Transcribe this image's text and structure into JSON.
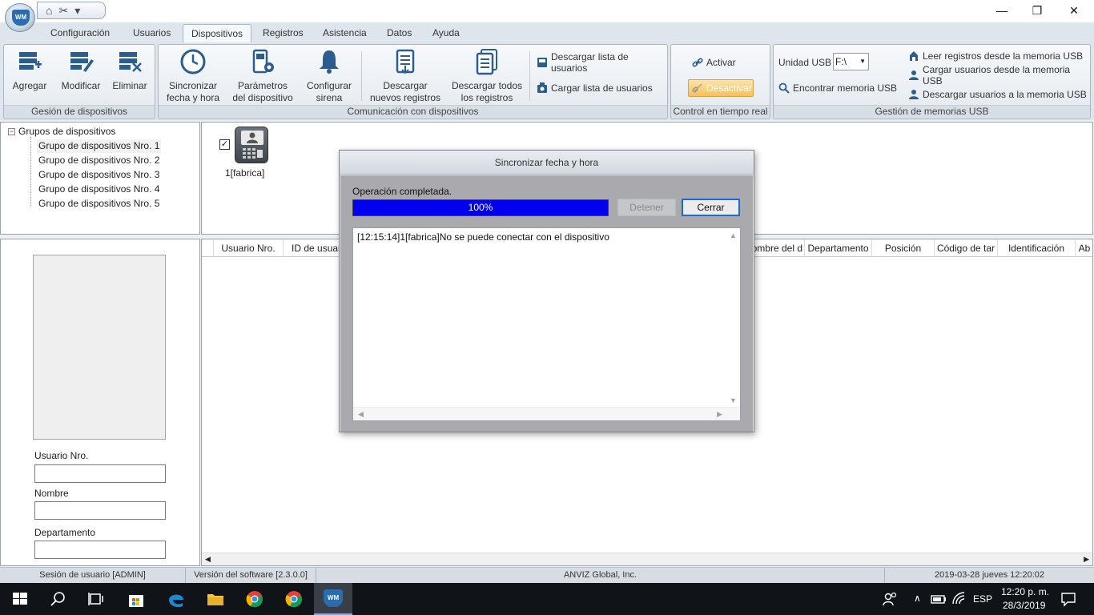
{
  "window": {
    "minimize": "—",
    "restore": "❐",
    "close": "✕"
  },
  "menu": {
    "tabs": [
      "Configuración",
      "Usuarios",
      "Dispositivos",
      "Registros",
      "Asistencia",
      "Datos",
      "Ayuda"
    ],
    "active": "Dispositivos"
  },
  "ribbon": {
    "gestion": {
      "label": "Gesión de dispositivos",
      "agregar": "Agregar",
      "modificar": "Modificar",
      "eliminar": "Eliminar"
    },
    "comunicacion": {
      "label": "Comunicación con dispositivos",
      "sync_line1": "Sincronizar",
      "sync_line2": "fecha y hora",
      "params_line1": "Parámetros",
      "params_line2": "del dispositivo",
      "sirena_line1": "Configurar",
      "sirena_line2": "sirena",
      "nuevos_line1": "Descargar",
      "nuevos_line2": "nuevos registros",
      "todos_line1": "Descargar todos",
      "todos_line2": "los registros",
      "descargar_lista": "Descargar lista de usuarios",
      "cargar_lista": "Cargar lista de usuarios"
    },
    "control": {
      "label": "Control en tiempo real",
      "activar": "Activar",
      "desactivar": "Desactivar"
    },
    "usb": {
      "label": "Gestión de memorias USB",
      "unidad_label": "Unidad USB",
      "unidad_value": "F:\\",
      "encontrar": "Encontrar memoria USB",
      "leer": "Leer registros desde la memoria USB",
      "cargar": "Cargar usuarios desde la memoria USB",
      "descargar": "Descargar usuarios a la memoria USB"
    }
  },
  "tree": {
    "root": "Grupos de dispositivos",
    "items": [
      "Grupo de dispositivos Nro. 1",
      "Grupo de dispositivos Nro. 2",
      "Grupo de dispositivos Nro. 3",
      "Grupo de dispositivos Nro. 4",
      "Grupo de dispositivos Nro. 5"
    ]
  },
  "device": {
    "checked": "✓",
    "label": "1[fabrica]"
  },
  "user_panel": {
    "usuario_nro": "Usuario Nro.",
    "nombre": "Nombre",
    "departamento": "Departamento"
  },
  "grid": {
    "columns": [
      "Usuario Nro.",
      "ID de usuar",
      "",
      "",
      "",
      "",
      "",
      "ombre del d",
      "Departamento",
      "Posición",
      "Código de tar",
      "Identificación",
      "Ab"
    ]
  },
  "statusbar": {
    "session": "Sesión de usuario  [ADMIN]",
    "version": "Versión del software  [2.3.0.0]",
    "company": "ANVIZ Global, Inc.",
    "datetime": "2019-03-28 jueves 12:20:02"
  },
  "dialog": {
    "title": "Sincronizar fecha y hora",
    "status": "Operación completada.",
    "progress_percent": 100,
    "progress_text": "100%",
    "stop_button": "Detener",
    "close_button": "Cerrar",
    "log": "[12:15:14]1[fabrica]No se puede conectar con el dispositivo"
  },
  "taskbar": {
    "lang": "ESP",
    "time": "12:20 p. m.",
    "date": "28/3/2019"
  },
  "colors": {
    "progress_fill": "#0000ee",
    "accent_blue": "#2b6cb0",
    "desactivar_bg": "#f7c873"
  }
}
